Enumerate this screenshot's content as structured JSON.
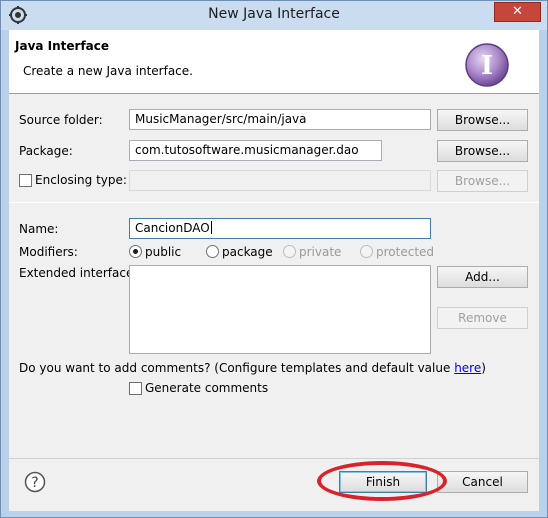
{
  "window": {
    "title": "New Java Interface",
    "close_glyph": "✕"
  },
  "header": {
    "title": "Java Interface",
    "description": "Create a new Java interface."
  },
  "form": {
    "source_folder": {
      "label": "Source folder:",
      "value": "MusicManager/src/main/java",
      "button": "Browse..."
    },
    "package": {
      "label": "Package:",
      "value": "com.tutosoftware.musicmanager.dao",
      "button": "Browse..."
    },
    "enclosing_type": {
      "label": "Enclosing type:",
      "value": "",
      "button": "Browse...",
      "checked": false
    },
    "name": {
      "label": "Name:",
      "value": "CancionDAO"
    },
    "modifiers": {
      "label": "Modifiers:",
      "options": [
        {
          "label": "public",
          "checked": true,
          "enabled": true
        },
        {
          "label": "package",
          "checked": false,
          "enabled": true
        },
        {
          "label": "private",
          "checked": false,
          "enabled": false
        },
        {
          "label": "protected",
          "checked": false,
          "enabled": false
        }
      ]
    },
    "extended_interfaces": {
      "label": "Extended interfaces:",
      "add_button": "Add...",
      "remove_button": "Remove"
    },
    "comments": {
      "question": "Do you want to add comments? (Configure templates and default value ",
      "link": "here",
      "suffix": ")",
      "checkbox_label": "Generate comments",
      "checked": false
    }
  },
  "footer": {
    "help_glyph": "?",
    "finish_button": "Finish",
    "cancel_button": "Cancel"
  },
  "colors": {
    "accent": "#3c7fb1",
    "annotation": "#d8232a"
  }
}
